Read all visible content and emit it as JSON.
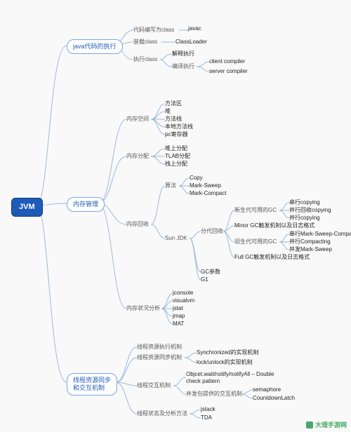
{
  "root": "JVM",
  "branches": {
    "code_exec": {
      "label": "java代码的执行",
      "compile": {
        "label": "代码编写为class",
        "leaf": "javac"
      },
      "load": {
        "label": "装载class",
        "leaf": "ClassLoader"
      },
      "run": {
        "label": "执行class",
        "interpret": "解释执行",
        "compile": {
          "label": "编译执行",
          "client": "client compiler",
          "server": "server compiler"
        }
      }
    },
    "memory": {
      "label": "内存管理",
      "space": {
        "label": "内存空间",
        "areas": [
          "方法区",
          "堆",
          "方法栈",
          "本地方法栈",
          "pc寄存器"
        ]
      },
      "alloc": {
        "label": "内存分配",
        "items": [
          "堆上分配",
          "TLAB分配",
          "栈上分配"
        ]
      },
      "gc": {
        "label": "内存回收",
        "algo": {
          "label": "算法",
          "items": [
            "Copy",
            "Mark-Sweep",
            "Mark-Compact"
          ]
        },
        "sunjdk": {
          "label": "Sun JDK",
          "gen": {
            "label": "分代回收",
            "young": {
              "label": "新生代可用的GC",
              "items": [
                "串行copying",
                "并行回收copying",
                "并行copying"
              ]
            },
            "minor": "Minor GC触发机制以及日志格式",
            "old": {
              "label": "旧生代可用的GC",
              "items": [
                "串行Mark-Sweep-Compact",
                "并行Compacting",
                "并发Mark-Sweep"
              ]
            },
            "full": "Full GC触发机制以及日志格式"
          },
          "gcparam": "GC参数",
          "g1": "G1"
        }
      },
      "analysis": {
        "label": "内存状况分析",
        "items": [
          "jconsole",
          "visualvm",
          "jstat",
          "jmap",
          "MAT"
        ]
      }
    },
    "thread": {
      "label": "线程资源同步\n和交互机制",
      "exec": {
        "label": "线程资源执行机制"
      },
      "sync": {
        "label": "线程资源同步机制",
        "items": [
          "Synchronized的实现机制",
          "lock/unlock的实现机制"
        ]
      },
      "interact": {
        "label": "线程交互机制",
        "wait": "Objcet.wait/notify/notifyAll – Double check pattern",
        "concurrent": {
          "label": "并发包提供的交互机制",
          "items": [
            "semaphore",
            "CountdownLatch"
          ]
        }
      },
      "status": {
        "label": "线程状态及分析方法",
        "items": [
          "jstack",
          "TDA"
        ]
      }
    }
  },
  "watermark": "大理手游网"
}
